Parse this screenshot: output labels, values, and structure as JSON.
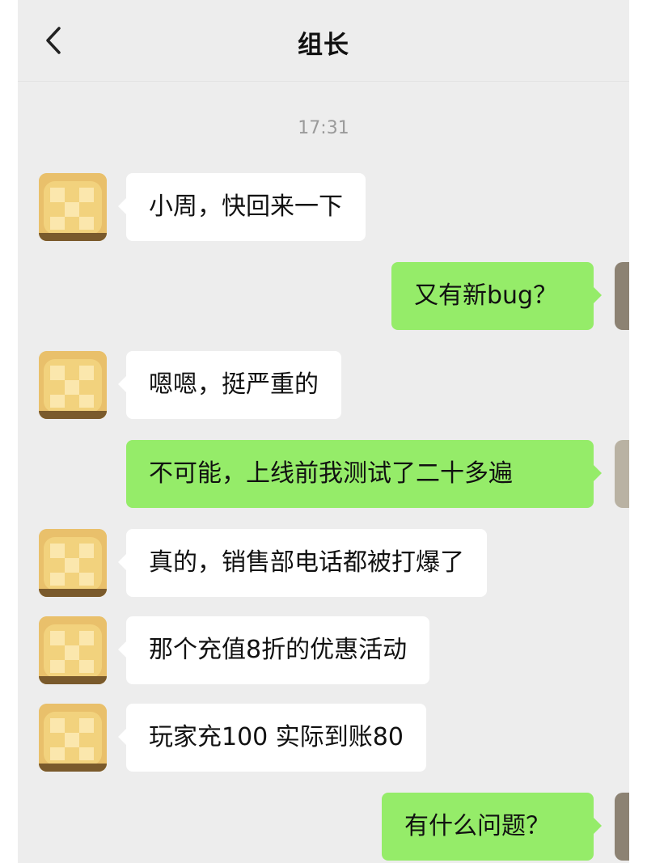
{
  "header": {
    "title": "组长"
  },
  "chat": {
    "timestamp": "17:31",
    "messages": [
      {
        "side": "left",
        "text": "小周，快回来一下"
      },
      {
        "side": "right",
        "text": "又有新bug？"
      },
      {
        "side": "left",
        "text": "嗯嗯，挺严重的"
      },
      {
        "side": "right",
        "text": "不可能，上线前我测试了二十多遍"
      },
      {
        "side": "left",
        "text": "真的，销售部电话都被打爆了"
      },
      {
        "side": "left",
        "text": "那个充值8折的优惠活动"
      },
      {
        "side": "left",
        "text": "玩家充100 实际到账80"
      },
      {
        "side": "right",
        "text": "有什么问题？"
      }
    ]
  },
  "colors": {
    "background": "#ededed",
    "incoming_bubble": "#ffffff",
    "outgoing_bubble": "#95ec69",
    "timestamp_text": "#9a9a9a"
  },
  "icons": {
    "back": "chevron-left-icon",
    "contact_avatar": "checkered-cake-avatar",
    "self_avatar": "self-avatar"
  }
}
